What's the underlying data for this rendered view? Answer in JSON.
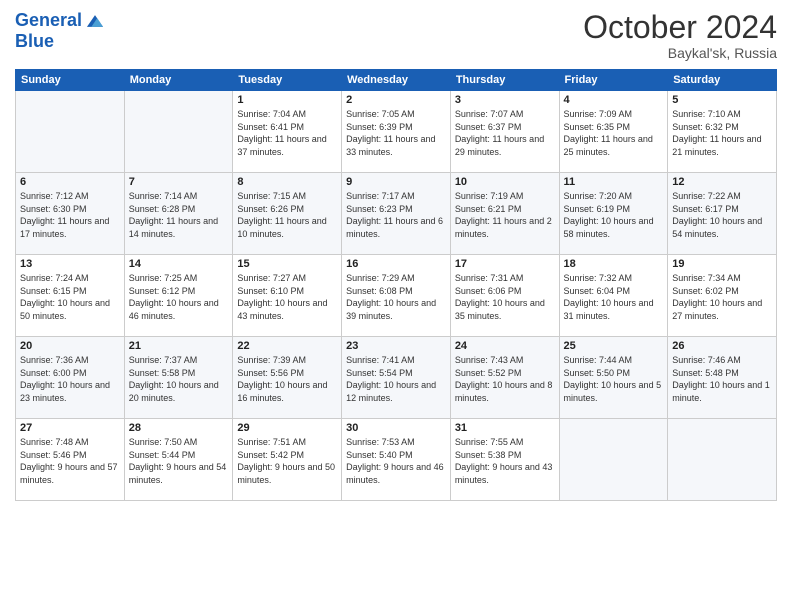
{
  "header": {
    "logo_line1": "General",
    "logo_line2": "Blue",
    "month": "October 2024",
    "location": "Baykal'sk, Russia"
  },
  "weekdays": [
    "Sunday",
    "Monday",
    "Tuesday",
    "Wednesday",
    "Thursday",
    "Friday",
    "Saturday"
  ],
  "weeks": [
    [
      {
        "day": "",
        "sunrise": "",
        "sunset": "",
        "daylight": ""
      },
      {
        "day": "",
        "sunrise": "",
        "sunset": "",
        "daylight": ""
      },
      {
        "day": "1",
        "sunrise": "Sunrise: 7:04 AM",
        "sunset": "Sunset: 6:41 PM",
        "daylight": "Daylight: 11 hours and 37 minutes."
      },
      {
        "day": "2",
        "sunrise": "Sunrise: 7:05 AM",
        "sunset": "Sunset: 6:39 PM",
        "daylight": "Daylight: 11 hours and 33 minutes."
      },
      {
        "day": "3",
        "sunrise": "Sunrise: 7:07 AM",
        "sunset": "Sunset: 6:37 PM",
        "daylight": "Daylight: 11 hours and 29 minutes."
      },
      {
        "day": "4",
        "sunrise": "Sunrise: 7:09 AM",
        "sunset": "Sunset: 6:35 PM",
        "daylight": "Daylight: 11 hours and 25 minutes."
      },
      {
        "day": "5",
        "sunrise": "Sunrise: 7:10 AM",
        "sunset": "Sunset: 6:32 PM",
        "daylight": "Daylight: 11 hours and 21 minutes."
      }
    ],
    [
      {
        "day": "6",
        "sunrise": "Sunrise: 7:12 AM",
        "sunset": "Sunset: 6:30 PM",
        "daylight": "Daylight: 11 hours and 17 minutes."
      },
      {
        "day": "7",
        "sunrise": "Sunrise: 7:14 AM",
        "sunset": "Sunset: 6:28 PM",
        "daylight": "Daylight: 11 hours and 14 minutes."
      },
      {
        "day": "8",
        "sunrise": "Sunrise: 7:15 AM",
        "sunset": "Sunset: 6:26 PM",
        "daylight": "Daylight: 11 hours and 10 minutes."
      },
      {
        "day": "9",
        "sunrise": "Sunrise: 7:17 AM",
        "sunset": "Sunset: 6:23 PM",
        "daylight": "Daylight: 11 hours and 6 minutes."
      },
      {
        "day": "10",
        "sunrise": "Sunrise: 7:19 AM",
        "sunset": "Sunset: 6:21 PM",
        "daylight": "Daylight: 11 hours and 2 minutes."
      },
      {
        "day": "11",
        "sunrise": "Sunrise: 7:20 AM",
        "sunset": "Sunset: 6:19 PM",
        "daylight": "Daylight: 10 hours and 58 minutes."
      },
      {
        "day": "12",
        "sunrise": "Sunrise: 7:22 AM",
        "sunset": "Sunset: 6:17 PM",
        "daylight": "Daylight: 10 hours and 54 minutes."
      }
    ],
    [
      {
        "day": "13",
        "sunrise": "Sunrise: 7:24 AM",
        "sunset": "Sunset: 6:15 PM",
        "daylight": "Daylight: 10 hours and 50 minutes."
      },
      {
        "day": "14",
        "sunrise": "Sunrise: 7:25 AM",
        "sunset": "Sunset: 6:12 PM",
        "daylight": "Daylight: 10 hours and 46 minutes."
      },
      {
        "day": "15",
        "sunrise": "Sunrise: 7:27 AM",
        "sunset": "Sunset: 6:10 PM",
        "daylight": "Daylight: 10 hours and 43 minutes."
      },
      {
        "day": "16",
        "sunrise": "Sunrise: 7:29 AM",
        "sunset": "Sunset: 6:08 PM",
        "daylight": "Daylight: 10 hours and 39 minutes."
      },
      {
        "day": "17",
        "sunrise": "Sunrise: 7:31 AM",
        "sunset": "Sunset: 6:06 PM",
        "daylight": "Daylight: 10 hours and 35 minutes."
      },
      {
        "day": "18",
        "sunrise": "Sunrise: 7:32 AM",
        "sunset": "Sunset: 6:04 PM",
        "daylight": "Daylight: 10 hours and 31 minutes."
      },
      {
        "day": "19",
        "sunrise": "Sunrise: 7:34 AM",
        "sunset": "Sunset: 6:02 PM",
        "daylight": "Daylight: 10 hours and 27 minutes."
      }
    ],
    [
      {
        "day": "20",
        "sunrise": "Sunrise: 7:36 AM",
        "sunset": "Sunset: 6:00 PM",
        "daylight": "Daylight: 10 hours and 23 minutes."
      },
      {
        "day": "21",
        "sunrise": "Sunrise: 7:37 AM",
        "sunset": "Sunset: 5:58 PM",
        "daylight": "Daylight: 10 hours and 20 minutes."
      },
      {
        "day": "22",
        "sunrise": "Sunrise: 7:39 AM",
        "sunset": "Sunset: 5:56 PM",
        "daylight": "Daylight: 10 hours and 16 minutes."
      },
      {
        "day": "23",
        "sunrise": "Sunrise: 7:41 AM",
        "sunset": "Sunset: 5:54 PM",
        "daylight": "Daylight: 10 hours and 12 minutes."
      },
      {
        "day": "24",
        "sunrise": "Sunrise: 7:43 AM",
        "sunset": "Sunset: 5:52 PM",
        "daylight": "Daylight: 10 hours and 8 minutes."
      },
      {
        "day": "25",
        "sunrise": "Sunrise: 7:44 AM",
        "sunset": "Sunset: 5:50 PM",
        "daylight": "Daylight: 10 hours and 5 minutes."
      },
      {
        "day": "26",
        "sunrise": "Sunrise: 7:46 AM",
        "sunset": "Sunset: 5:48 PM",
        "daylight": "Daylight: 10 hours and 1 minute."
      }
    ],
    [
      {
        "day": "27",
        "sunrise": "Sunrise: 7:48 AM",
        "sunset": "Sunset: 5:46 PM",
        "daylight": "Daylight: 9 hours and 57 minutes."
      },
      {
        "day": "28",
        "sunrise": "Sunrise: 7:50 AM",
        "sunset": "Sunset: 5:44 PM",
        "daylight": "Daylight: 9 hours and 54 minutes."
      },
      {
        "day": "29",
        "sunrise": "Sunrise: 7:51 AM",
        "sunset": "Sunset: 5:42 PM",
        "daylight": "Daylight: 9 hours and 50 minutes."
      },
      {
        "day": "30",
        "sunrise": "Sunrise: 7:53 AM",
        "sunset": "Sunset: 5:40 PM",
        "daylight": "Daylight: 9 hours and 46 minutes."
      },
      {
        "day": "31",
        "sunrise": "Sunrise: 7:55 AM",
        "sunset": "Sunset: 5:38 PM",
        "daylight": "Daylight: 9 hours and 43 minutes."
      },
      {
        "day": "",
        "sunrise": "",
        "sunset": "",
        "daylight": ""
      },
      {
        "day": "",
        "sunrise": "",
        "sunset": "",
        "daylight": ""
      }
    ]
  ]
}
